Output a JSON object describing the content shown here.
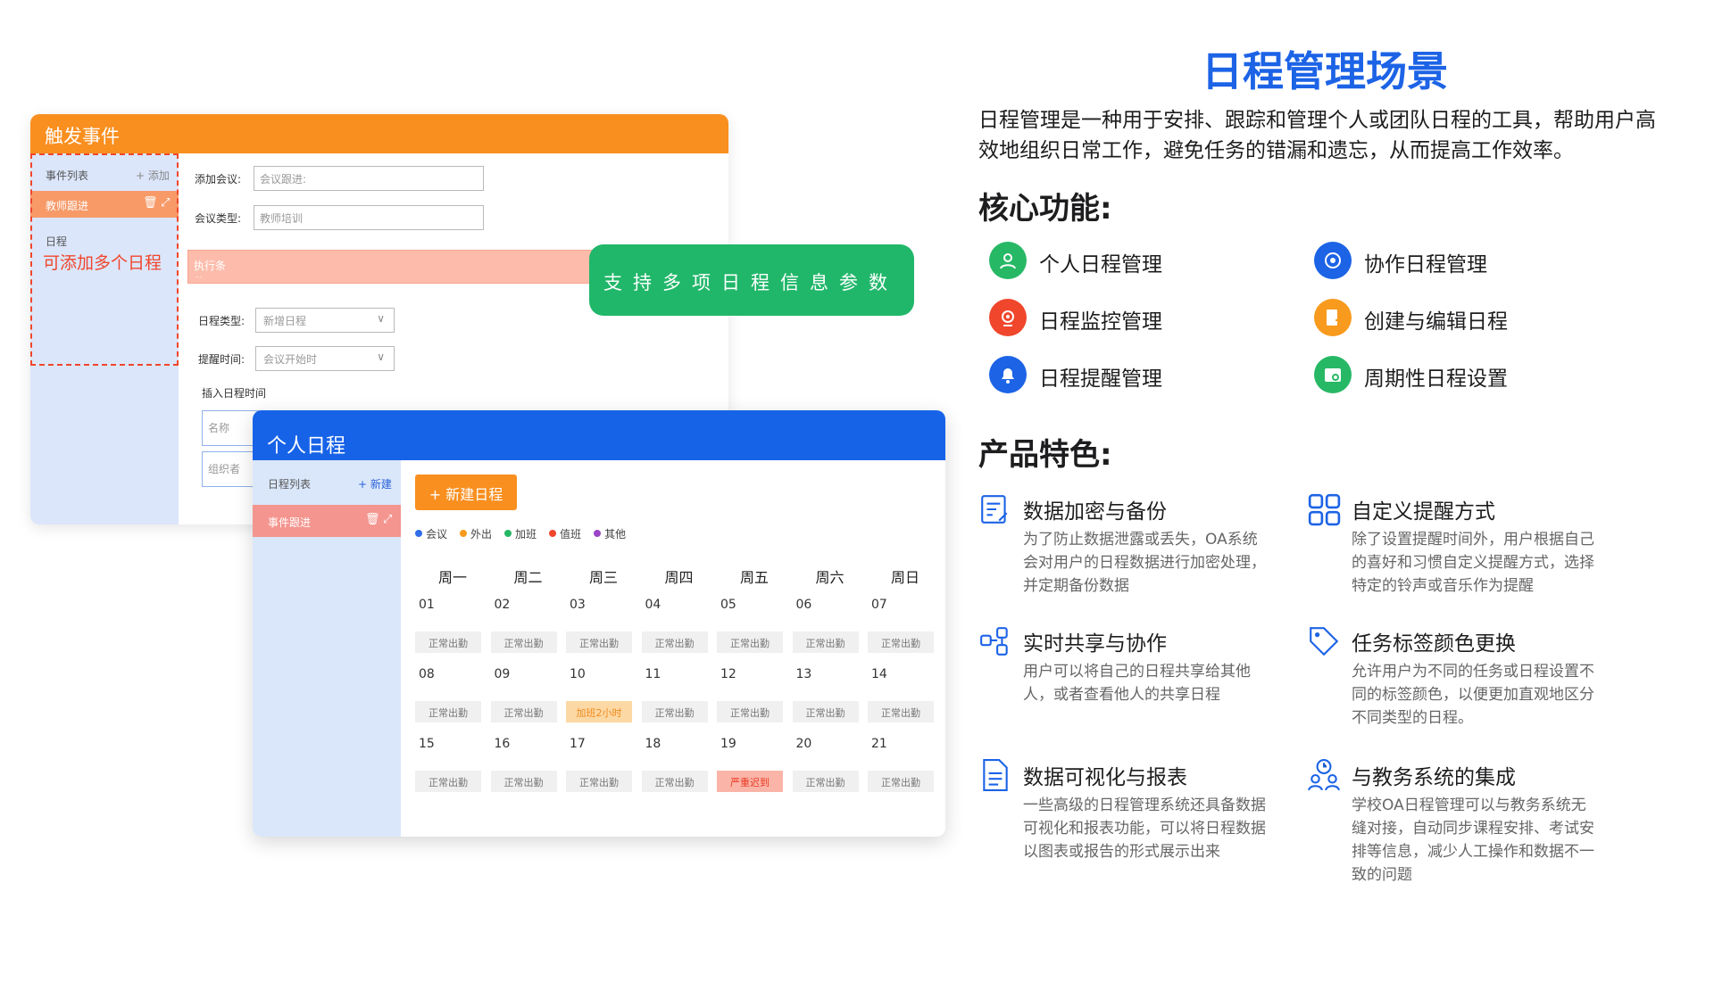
{
  "trigger_card": {
    "title": "触发事件",
    "list_title": "事件列表",
    "add_label": "+ 添加",
    "active_item": "教师跟进",
    "schedule_label": "日程",
    "note": "可添加多个日程",
    "add_meeting_label": "添加会议:",
    "add_meeting_value": "会议跟进:",
    "meeting_type_label": "会议类型:",
    "meeting_type_value": "教师培训",
    "exec_condition": "执行条件:",
    "schedule_type_label": "日程类型:",
    "schedule_type_value": "新增日程",
    "remind_time_label": "提醒时间:",
    "remind_time_value": "会议开始时",
    "insert_time_label": "插入日程时间",
    "name_label": "名称",
    "organizer_label": "组织者"
  },
  "badge": {
    "text": "支持多项日程信息参数"
  },
  "personal_card": {
    "title": "个人日程",
    "list_title": "日程列表",
    "new_label": "+ 新建",
    "active_item": "事件跟进",
    "new_button": "+ 新建日程",
    "legend": [
      {
        "label": "会议",
        "color": "#2f6ee8"
      },
      {
        "label": "外出",
        "color": "#f79a1d"
      },
      {
        "label": "加班",
        "color": "#26b865"
      },
      {
        "label": "值班",
        "color": "#f0462c"
      },
      {
        "label": "其他",
        "color": "#9b45c8"
      }
    ],
    "weekdays": [
      "周一",
      "周二",
      "周三",
      "周四",
      "周五",
      "周六",
      "周日"
    ],
    "days": [
      {
        "date": "01",
        "status": "正常出勤"
      },
      {
        "date": "02",
        "status": "正常出勤"
      },
      {
        "date": "03",
        "status": "正常出勤"
      },
      {
        "date": "04",
        "status": "正常出勤"
      },
      {
        "date": "05",
        "status": "正常出勤"
      },
      {
        "date": "06",
        "status": "正常出勤"
      },
      {
        "date": "07",
        "status": "正常出勤"
      },
      {
        "date": "08",
        "status": "正常出勤"
      },
      {
        "date": "09",
        "status": "正常出勤"
      },
      {
        "date": "10",
        "status": "加班2小时",
        "kind": "ot"
      },
      {
        "date": "11",
        "status": "正常出勤"
      },
      {
        "date": "12",
        "status": "正常出勤"
      },
      {
        "date": "13",
        "status": "正常出勤"
      },
      {
        "date": "14",
        "status": "正常出勤"
      },
      {
        "date": "15",
        "status": "正常出勤"
      },
      {
        "date": "16",
        "status": "正常出勤"
      },
      {
        "date": "17",
        "status": "正常出勤"
      },
      {
        "date": "18",
        "status": "正常出勤"
      },
      {
        "date": "19",
        "status": "严重迟到",
        "kind": "late"
      },
      {
        "date": "20",
        "status": "正常出勤"
      },
      {
        "date": "21",
        "status": "正常出勤"
      }
    ]
  },
  "info": {
    "title": "日程管理场景",
    "intro": "日程管理是一种用于安排、跟踪和管理个人或团队日程的工具，帮助用户高效地组织日常工作，避免任务的错漏和遗忘，从而提高工作效率。",
    "core_heading": "核心功能:",
    "core_items": [
      {
        "label": "个人日程管理",
        "icon": "person-icon",
        "color": "#27b866"
      },
      {
        "label": "协作日程管理",
        "icon": "collaboration-icon",
        "color": "#1c63e6"
      },
      {
        "label": "日程监控管理",
        "icon": "monitor-camera-icon",
        "color": "#f0462c"
      },
      {
        "label": "创建与编辑日程",
        "icon": "edit-document-icon",
        "color": "#f79a1d"
      },
      {
        "label": "日程提醒管理",
        "icon": "bell-icon",
        "color": "#1c63e6"
      },
      {
        "label": "周期性日程设置",
        "icon": "calendar-cycle-icon",
        "color": "#27b866"
      }
    ],
    "feature_heading": "产品特色:",
    "features": [
      {
        "title": "数据加密与备份",
        "desc": "为了防止数据泄露或丢失，OA系统会对用户的日程数据进行加密处理，并定期备份数据",
        "icon": "encrypt-backup-icon"
      },
      {
        "title": "自定义提醒方式",
        "desc": "除了设置提醒时间外，用户根据自己的喜好和习惯自定义提醒方式，选择特定的铃声或音乐作为提醒",
        "icon": "grid-apps-icon"
      },
      {
        "title": "实时共享与协作",
        "desc": "用户可以将自己的日程共享给其他人，或者查看他人的共享日程",
        "icon": "share-sync-icon"
      },
      {
        "title": "任务标签颜色更换",
        "desc": "允许用户为不同的任务或日程设置不同的标签颜色，以便更加直观地区分不同类型的日程。",
        "icon": "tag-icon"
      },
      {
        "title": "数据可视化与报表",
        "desc": "一些高级的日程管理系统还具备数据可视化和报表功能，可以将日程数据以图表或报告的形式展示出来",
        "icon": "report-document-icon"
      },
      {
        "title": "与教务系统的集成",
        "desc": "学校OA日程管理可以与教务系统无缝对接，自动同步课程安排、考试安排等信息，减少人工操作和数据不一致的问题",
        "icon": "people-clock-icon"
      }
    ]
  }
}
